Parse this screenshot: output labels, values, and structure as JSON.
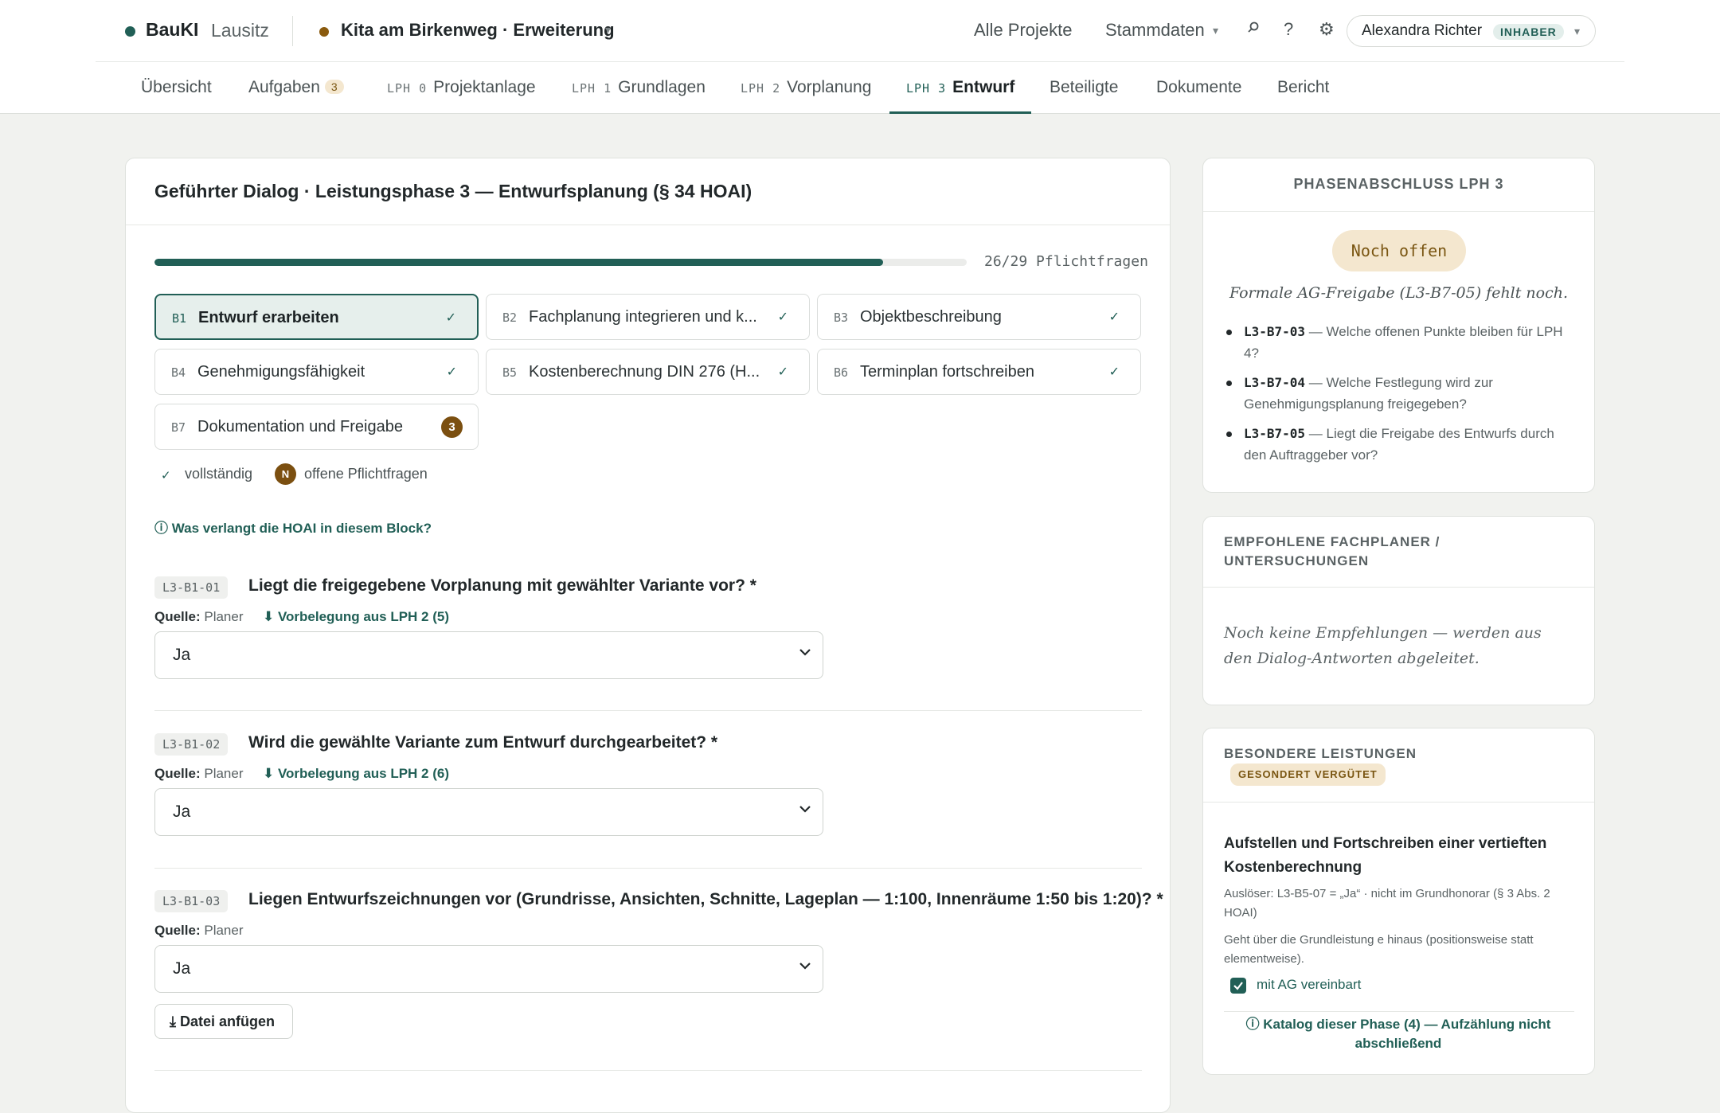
{
  "app": {
    "brand": "BauKI",
    "brand_sub": "Lausitz"
  },
  "project": {
    "title": "Kita am Birkenweg · Erweiterung"
  },
  "topnav": {
    "all_projects": "Alle Projekte",
    "master_data": "Stammdaten"
  },
  "user": {
    "name": "Alexandra Richter",
    "role": "INHABER"
  },
  "tabs": [
    {
      "label": "Übersicht"
    },
    {
      "label": "Aufgaben",
      "count": "3"
    },
    {
      "prefix": "LPH 0",
      "label": "Projektanlage"
    },
    {
      "prefix": "LPH 1",
      "label": "Grundlagen"
    },
    {
      "prefix": "LPH 2",
      "label": "Vorplanung"
    },
    {
      "prefix": "LPH 3",
      "label": "Entwurf"
    },
    {
      "label": "Beteiligte"
    },
    {
      "label": "Dokumente"
    },
    {
      "label": "Bericht"
    }
  ],
  "dialog": {
    "title": "Geführter Dialog · Leistungsphase 3 — Entwurfsplanung (§ 34 HOAI)",
    "progress_fraction": 0.8966,
    "progress_label": "26/29 Pflichtfragen",
    "blocks": [
      {
        "id": "B1",
        "label": "Entwurf erarbeiten",
        "status": "✓"
      },
      {
        "id": "B2",
        "label": "Fachplanung integrieren und k...",
        "status": "✓"
      },
      {
        "id": "B3",
        "label": "Objektbeschreibung",
        "status": "✓"
      },
      {
        "id": "B4",
        "label": "Genehmigungsfähigkeit",
        "status": "✓"
      },
      {
        "id": "B5",
        "label": "Kostenberechnung DIN 276 (H...",
        "status": "✓"
      },
      {
        "id": "B6",
        "label": "Terminplan fortschreiben",
        "status": "✓"
      },
      {
        "id": "B7",
        "label": "Dokumentation und Freigabe",
        "open": "3"
      }
    ],
    "legend": {
      "complete_mark": "✓",
      "complete": "vollständig",
      "open_mark": "N",
      "open": "offene Pflichtfragen"
    },
    "hoai_link": "ⓘ Was verlangt die HOAI in diesem Block?",
    "questions": [
      {
        "id": "L3-B1-01",
        "text": "Liegt die freigegebene Vorplanung mit gewählter Variante vor? *",
        "source_label": "Quelle:",
        "source": "Planer",
        "prefill": "⬇ Vorbelegung aus LPH 2 (5)",
        "value": "Ja"
      },
      {
        "id": "L3-B1-02",
        "text": "Wird die gewählte Variante zum Entwurf durchgearbeitet? *",
        "source_label": "Quelle:",
        "source": "Planer",
        "prefill": "⬇ Vorbelegung aus LPH 2 (6)",
        "value": "Ja"
      },
      {
        "id": "L3-B1-03",
        "text": "Liegen Entwurfszeichnungen vor (Grundrisse, Ansichten, Schnitte, Lageplan — 1:100, Innenräume 1:50 bis 1:20)? *",
        "source_label": "Quelle:",
        "source": "Planer",
        "value": "Ja",
        "attach": "⤓ Datei anfügen"
      }
    ]
  },
  "phase_close": {
    "title": "PHASENABSCHLUSS LPH 3",
    "status": "Noch offen",
    "note": "Formale AG-Freigabe (L3-B7-05) fehlt noch.",
    "items": [
      {
        "code": "L3-B7-03",
        "text": " — Welche offenen Punkte bleiben für LPH 4?"
      },
      {
        "code": "L3-B7-04",
        "text": " — Welche Festlegung wird zur Genehmigungsplanung freigegeben?"
      },
      {
        "code": "L3-B7-05",
        "text": " — Liegt die Freigabe des Entwurfs durch den Auftraggeber vor?"
      }
    ]
  },
  "recommended": {
    "title": "EMPFOHLENE FACHPLANER / UNTERSUCHUNGEN",
    "empty": "Noch keine Empfehlungen — werden aus den Dialog-Antworten abgeleitet."
  },
  "special": {
    "title": "BESONDERE LEISTUNGEN",
    "badge": "GESONDERT VERGÜTET",
    "item_title": "Aufstellen und Fortschreiben einer vertieften Kostenberechnung",
    "trigger": "Auslöser: L3-B5-07 = „Ja“ · nicht im Grundhonorar (§ 3 Abs. 2 HOAI)",
    "description": "Geht über die Grundleistung e hinaus (positionsweise statt elementweise).",
    "agreed_label": "mit AG vereinbart",
    "agreed": true,
    "catalog_link": "ⓘ Katalog dieser Phase (4) — Aufzählung nicht abschließend"
  },
  "colors": {
    "accent": "#215f56",
    "warning": "#7b4f10",
    "warning_bg": "#f4e7cf"
  },
  "icons": [
    "search-icon",
    "help-icon",
    "settings-icon",
    "chevron-down-icon",
    "check-icon",
    "info-icon",
    "download-icon"
  ]
}
